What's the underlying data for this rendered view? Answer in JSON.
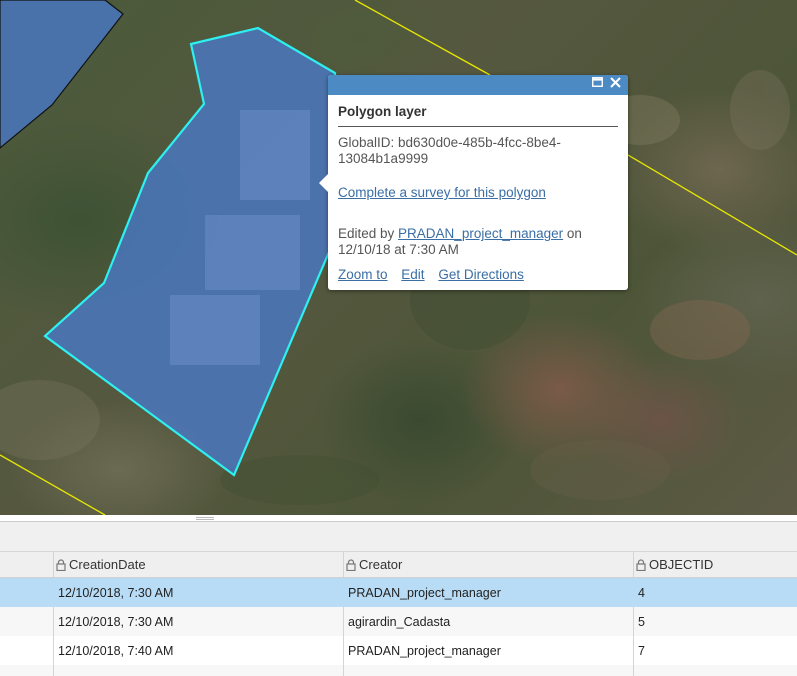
{
  "popup": {
    "layer_title": "Polygon layer",
    "global_id": "GlobalID: bd630d0e-485b-4fcc-8be4-13084b1a9999",
    "survey_link": "Complete a survey for this polygon",
    "edited_prefix": "Edited by ",
    "editor": "PRADAN_project_manager",
    "edited_on": " on",
    "edited_date": "12/10/18 at 7:30 AM",
    "zoom_to": "Zoom to",
    "edit": "Edit",
    "directions": "Get Directions",
    "maximize_icon": "maximize-icon",
    "close_icon": "close-icon"
  },
  "table": {
    "columns": [
      "CreationDate",
      "Creator",
      "OBJECTID"
    ],
    "rows": [
      {
        "creation_date": "12/10/2018, 7:30 AM",
        "creator": "PRADAN_project_manager",
        "objectid": "4"
      },
      {
        "creation_date": "12/10/2018, 7:30 AM",
        "creator": "agirardin_Cadasta",
        "objectid": "5"
      },
      {
        "creation_date": "12/10/2018, 7:40 AM",
        "creator": "PRADAN_project_manager",
        "objectid": "7"
      }
    ]
  },
  "colors": {
    "popup_header": "#4c8ac4",
    "polygon_fill": "#4a7bd0",
    "selection_outline": "#2ef0f0",
    "parcel_line": "#e8e800",
    "selected_row": "#b8dcf5"
  }
}
